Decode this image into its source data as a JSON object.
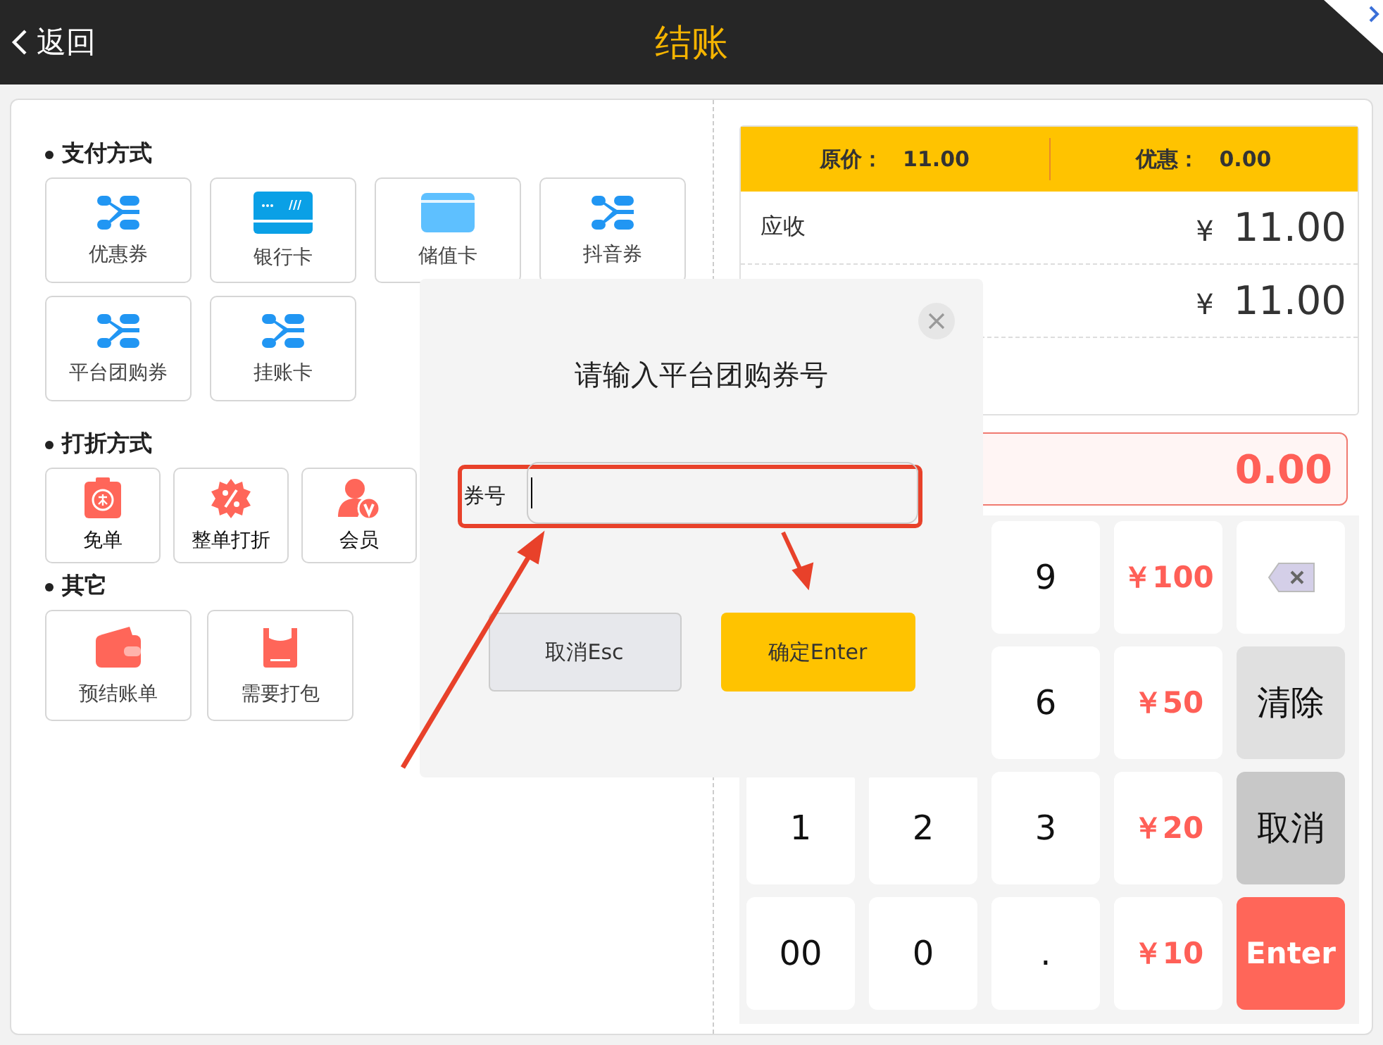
{
  "header": {
    "back": "返回",
    "title": "结账"
  },
  "sections": [
    {
      "title": "支付方式",
      "kind": "large",
      "items": [
        {
          "label": "优惠券"
        },
        {
          "label": "银行卡"
        },
        {
          "label": "储值卡"
        },
        {
          "label": "抖音券"
        },
        {
          "label": "平台团购券"
        },
        {
          "label": "挂账卡"
        }
      ]
    },
    {
      "title": "打折方式",
      "kind": "small",
      "items": [
        {
          "label": "免单"
        },
        {
          "label": "整单打折"
        },
        {
          "label": "会员"
        }
      ]
    },
    {
      "title": "其它",
      "kind": "tall",
      "items": [
        {
          "label": "预结账单"
        },
        {
          "label": "需要打包"
        }
      ]
    }
  ],
  "summary": {
    "original_label": "原价：",
    "original": "11.00",
    "discount_label": "优惠：",
    "discount": "0.00",
    "rows": [
      {
        "label": "应收",
        "currency": "¥",
        "amount": "11.00"
      },
      {
        "currency": "¥",
        "amount": "11.00"
      }
    ],
    "input_value": "0.00"
  },
  "keypad": [
    [
      {
        "kind": "digit",
        "label": "9"
      },
      {
        "kind": "cash",
        "label": "￥100"
      },
      {
        "kind": "backspace"
      }
    ],
    [
      {
        "kind": "digit",
        "label": "6"
      },
      {
        "kind": "cash",
        "label": "￥50"
      },
      {
        "kind": "clear",
        "label": "清除"
      }
    ],
    [
      {
        "kind": "digit",
        "label": "1"
      },
      {
        "kind": "digit",
        "label": "2"
      },
      {
        "kind": "digit",
        "label": "3"
      },
      {
        "kind": "cash",
        "label": "￥20"
      },
      {
        "kind": "cancel",
        "label": "取消"
      }
    ],
    [
      {
        "kind": "digit",
        "label": "00"
      },
      {
        "kind": "digit",
        "label": "0"
      },
      {
        "kind": "digit",
        "label": "."
      },
      {
        "kind": "cash",
        "label": "￥10"
      },
      {
        "kind": "enter",
        "label": "Enter"
      }
    ]
  ],
  "dialog": {
    "title": "请输入平台团购券号",
    "field_label": "券号",
    "highlighted": true,
    "cancel": "取消Esc",
    "confirm": "确定Enter"
  }
}
